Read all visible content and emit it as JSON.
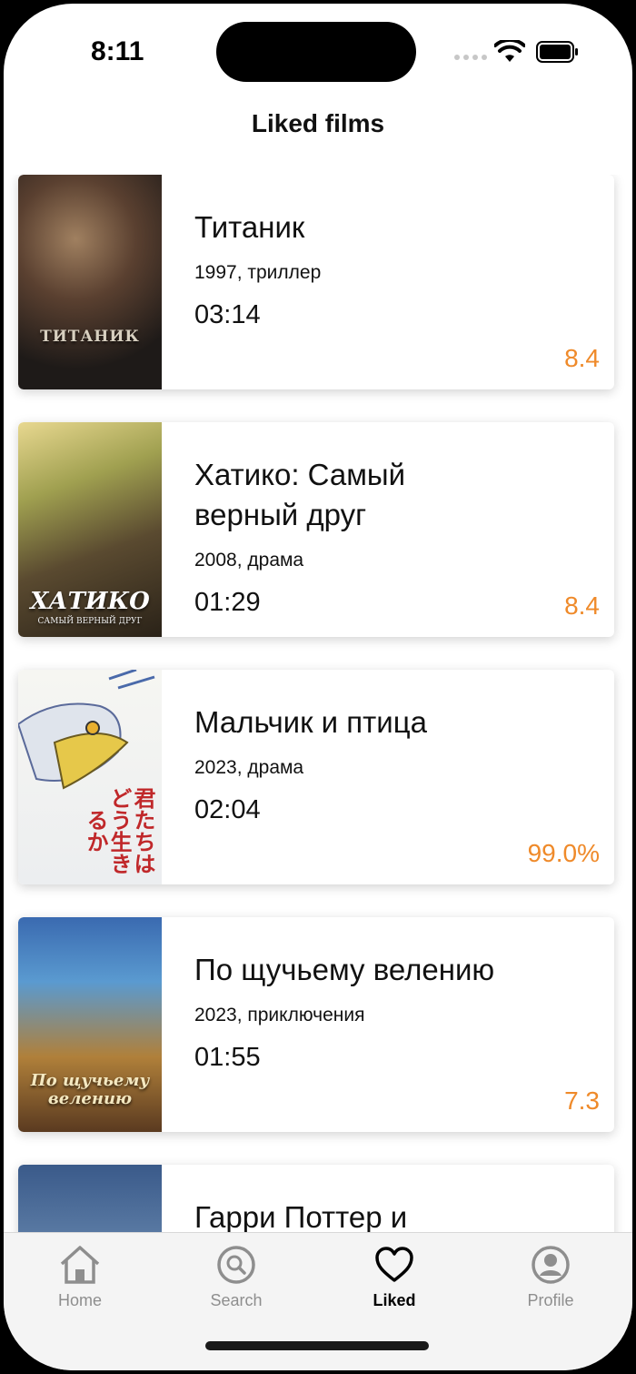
{
  "status_bar": {
    "time": "8:11",
    "icons": [
      "signal-icon",
      "wifi-icon",
      "battery-icon"
    ]
  },
  "header": {
    "title": "Liked films"
  },
  "films": [
    {
      "title": "Титаник",
      "meta": "1997, триллер",
      "duration": "03:14",
      "rating": "8.4",
      "poster_text": "ТИТАНИК"
    },
    {
      "title": "Хатико: Самый верный друг",
      "meta": "2008, драма",
      "duration": "01:29",
      "rating": "8.4",
      "poster_text": "ХАТИКО",
      "poster_subtext": "САМЫЙ ВЕРНЫЙ ДРУГ"
    },
    {
      "title": "Мальчик и птица",
      "meta": "2023, драма",
      "duration": "02:04",
      "rating": "99.0%",
      "poster_text": "君たちはどう生きるか"
    },
    {
      "title": "По щучьему велению",
      "meta": "2023, приключения",
      "duration": "01:55",
      "rating": "7.3",
      "poster_text": "По щучьему велению"
    },
    {
      "title": "Гарри Поттер и",
      "meta": "",
      "duration": "",
      "rating": ""
    }
  ],
  "tab_bar": {
    "tabs": [
      {
        "label": "Home",
        "icon": "home-icon",
        "active": false
      },
      {
        "label": "Search",
        "icon": "search-icon",
        "active": false
      },
      {
        "label": "Liked",
        "icon": "heart-icon",
        "active": true
      },
      {
        "label": "Profile",
        "icon": "profile-icon",
        "active": false
      }
    ]
  },
  "colors": {
    "rating": "#ef8a2a",
    "inactive_tab": "#8e8e8e",
    "active_tab": "#000000"
  }
}
